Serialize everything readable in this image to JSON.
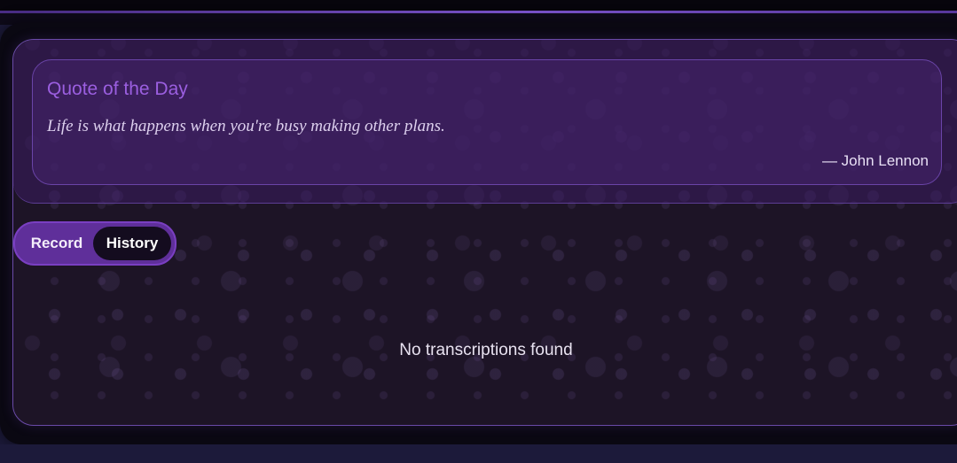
{
  "quote": {
    "title": "Quote of the Day",
    "text": "Life is what happens when you're busy making other plans.",
    "author": "— John Lennon"
  },
  "tabs": {
    "record_label": "Record",
    "history_label": "History",
    "active": "History"
  },
  "history": {
    "empty_message": "No transcriptions found"
  },
  "colors": {
    "accent": "#9b5fe0",
    "panel_border": "#6a4aa8",
    "tab_bg": "#5f2f9a",
    "tab_active_bg": "#140c1f"
  }
}
